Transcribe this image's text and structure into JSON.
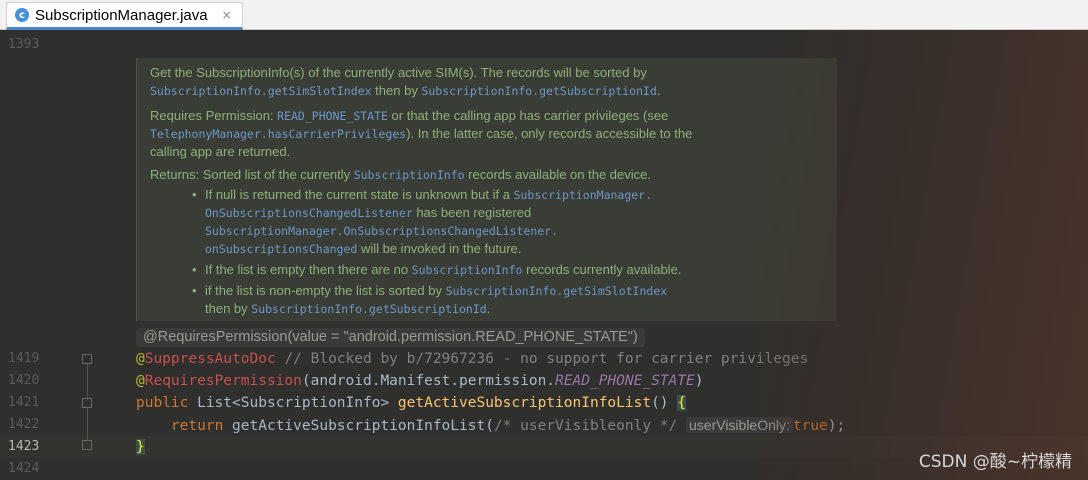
{
  "tab": {
    "icon_letter": "c",
    "title": "SubscriptionManager.java",
    "close_glyph": "×"
  },
  "gutter": {
    "lines": [
      "1393",
      "1419",
      "1420",
      "1421",
      "1422",
      "1423",
      "1424"
    ],
    "current": "1423"
  },
  "doc": {
    "p1": {
      "t1": "Get the SubscriptionInfo(s) of the currently active SIM(s). The records will be sorted by",
      "c1": "SubscriptionInfo.getSimSlotIndex",
      "t2": " then by ",
      "c2": "SubscriptionInfo.getSubscriptionId",
      "t3": "."
    },
    "p2": {
      "t1": "Requires Permission: ",
      "c1": "READ_PHONE_STATE",
      "t2": " or that the calling app has carrier privileges (see",
      "c2": "TelephonyManager.hasCarrierPrivileges",
      "t3": "). In the latter case, only records accessible to the",
      "t4": "calling app are returned."
    },
    "returns": {
      "t1": "Returns: Sorted list of the currently ",
      "c1": "SubscriptionInfo",
      "t2": " records available on the device."
    },
    "bullet": "•",
    "b1": {
      "t1": "If null is returned the current state is unknown but if a ",
      "c1": "SubscriptionManager.",
      "c2": "OnSubscriptionsChangedListener",
      "t2": " has been registered",
      "c3": "SubscriptionManager.OnSubscriptionsChangedListener.",
      "c4": "onSubscriptionsChanged",
      "t3": " will be invoked in the future."
    },
    "b2": {
      "t1": "If the list is empty then there are no ",
      "c1": "SubscriptionInfo",
      "t2": " records currently available."
    },
    "b3": {
      "t1": "if the list is non-empty the list is sorted by ",
      "c1": "SubscriptionInfo.getSimSlotIndex",
      "t2": "then by ",
      "c2": "SubscriptionInfo.getSubscriptionId",
      "t3": "."
    }
  },
  "inlay_hint": "@RequiresPermission(value = \"android.permission.READ_PHONE_STATE\")",
  "code": {
    "l1419": {
      "at": "@",
      "ann": "SuppressAutoDoc",
      "comment": " // Blocked by b/72967236 - no support for carrier privileges"
    },
    "l1420": {
      "at": "@",
      "ann": "RequiresPermission",
      "p1": "(android.Manifest.permission.",
      "const": "READ_PHONE_STATE",
      "p2": ")"
    },
    "l1421": {
      "kw": "public",
      "type": " List<SubscriptionInfo> ",
      "fn": "getActiveSubscriptionInfoList",
      "parens": "() ",
      "brace": "{"
    },
    "l1422": {
      "indent": "    ",
      "kw": "return",
      "call": " getActiveSubscriptionInfoList(",
      "comment": "/* userVisibleonly */",
      "hint": "userVisibleOnly:",
      "val": "true",
      "end": ");"
    },
    "l1423": {
      "brace": "}"
    }
  },
  "watermark": "CSDN @酸~柠檬精"
}
